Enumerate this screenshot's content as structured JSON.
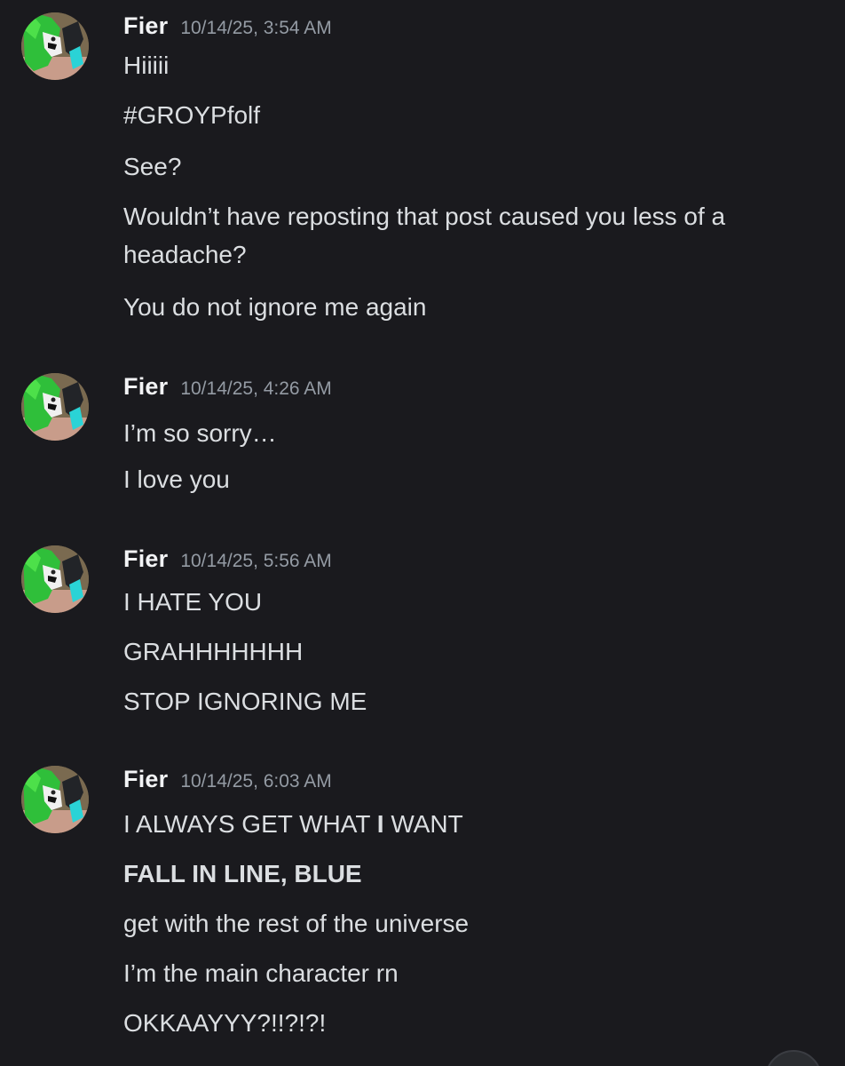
{
  "messages": [
    {
      "author": "Fier",
      "timestamp": "10/14/25, 3:54 AM",
      "lines": [
        "Hiiiii",
        "#GROYPfolf",
        "See?",
        "Wouldn’t have reposting that post caused you less of a headache?",
        "You do not ignore me again"
      ]
    },
    {
      "author": "Fier",
      "timestamp": "10/14/25, 4:26 AM",
      "lines": [
        "I’m so sorry…",
        "I love you"
      ]
    },
    {
      "author": "Fier",
      "timestamp": "10/14/25, 5:56 AM",
      "lines": [
        "I HATE YOU",
        "GRAHHHHHHH",
        "STOP IGNORING ME"
      ]
    },
    {
      "author": "Fier",
      "timestamp": "10/14/25, 6:03 AM",
      "lines": [
        {
          "pre": "I ALWAYS GET WHAT ",
          "bold": "I",
          "post": " WANT"
        },
        "FALL IN LINE, BLUE",
        "get with the rest of the universe",
        "I’m the main character rn",
        "OKKAAYYY?!!?!?!"
      ]
    }
  ],
  "colors": {
    "background": "#1a1a1e",
    "author": "#f2f3f5",
    "timestamp": "#949ba4",
    "text": "#dbdee1",
    "avatar_green": "#2fbf3a",
    "avatar_cyan": "#2ad3d6"
  }
}
